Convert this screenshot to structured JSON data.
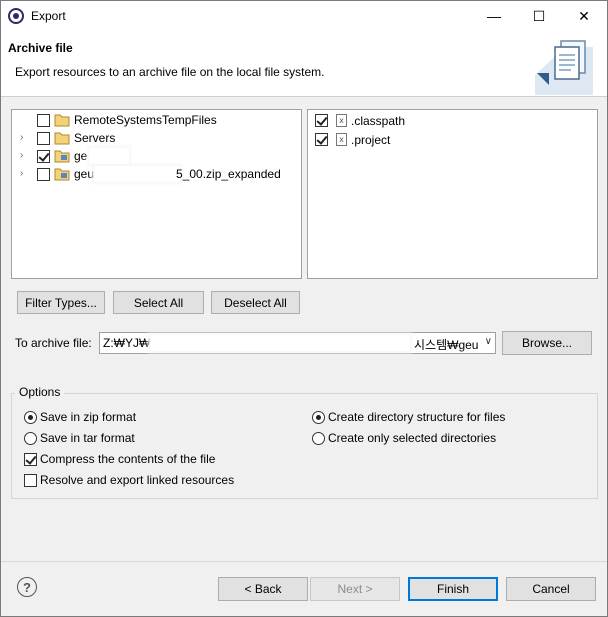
{
  "window": {
    "title": "Export",
    "controls": {
      "minimize": "—",
      "maximize": "☐",
      "close": "✕"
    }
  },
  "banner": {
    "title": "Archive file",
    "description": "Export resources to an archive file on the local file system.",
    "icon": "export-wizard-icon"
  },
  "tree": {
    "items": [
      {
        "label": "RemoteSystemsTempFiles",
        "expandable": false,
        "checked": false,
        "icon": "folder-icon"
      },
      {
        "label": "Servers",
        "expandable": true,
        "checked": false,
        "icon": "folder-icon"
      },
      {
        "label": "ge",
        "expandable": true,
        "checked": true,
        "icon": "project-folder-icon"
      },
      {
        "label_start": "geu",
        "label_end": "5_00.zip_expanded",
        "expandable": true,
        "checked": false,
        "icon": "project-folder-icon"
      }
    ]
  },
  "files": {
    "items": [
      {
        "label": ".classpath",
        "checked": true,
        "icon": "file-icon"
      },
      {
        "label": ".project",
        "checked": true,
        "icon": "file-icon"
      }
    ]
  },
  "selection_buttons": {
    "filter": "Filter Types...",
    "select_all": "Select All",
    "deselect_all": "Deselect All"
  },
  "archive": {
    "label": "To archive file:",
    "value_start": "Z:₩YJ₩?",
    "value_end": "시스템₩geu",
    "browse": "Browse..."
  },
  "options": {
    "legend": "Options",
    "save_zip": "Save in zip format",
    "save_tar": "Save in tar format",
    "compress": "Compress the contents of the file",
    "resolve_links": "Resolve and export linked resources",
    "create_structure": "Create directory structure for files",
    "create_selected": "Create only selected directories",
    "state": {
      "save_zip": true,
      "save_tar": false,
      "compress": true,
      "resolve_links": false,
      "create_structure": true,
      "create_selected": false
    }
  },
  "footer": {
    "help": "?",
    "back": "< Back",
    "next": "Next >",
    "finish": "Finish",
    "cancel": "Cancel"
  }
}
